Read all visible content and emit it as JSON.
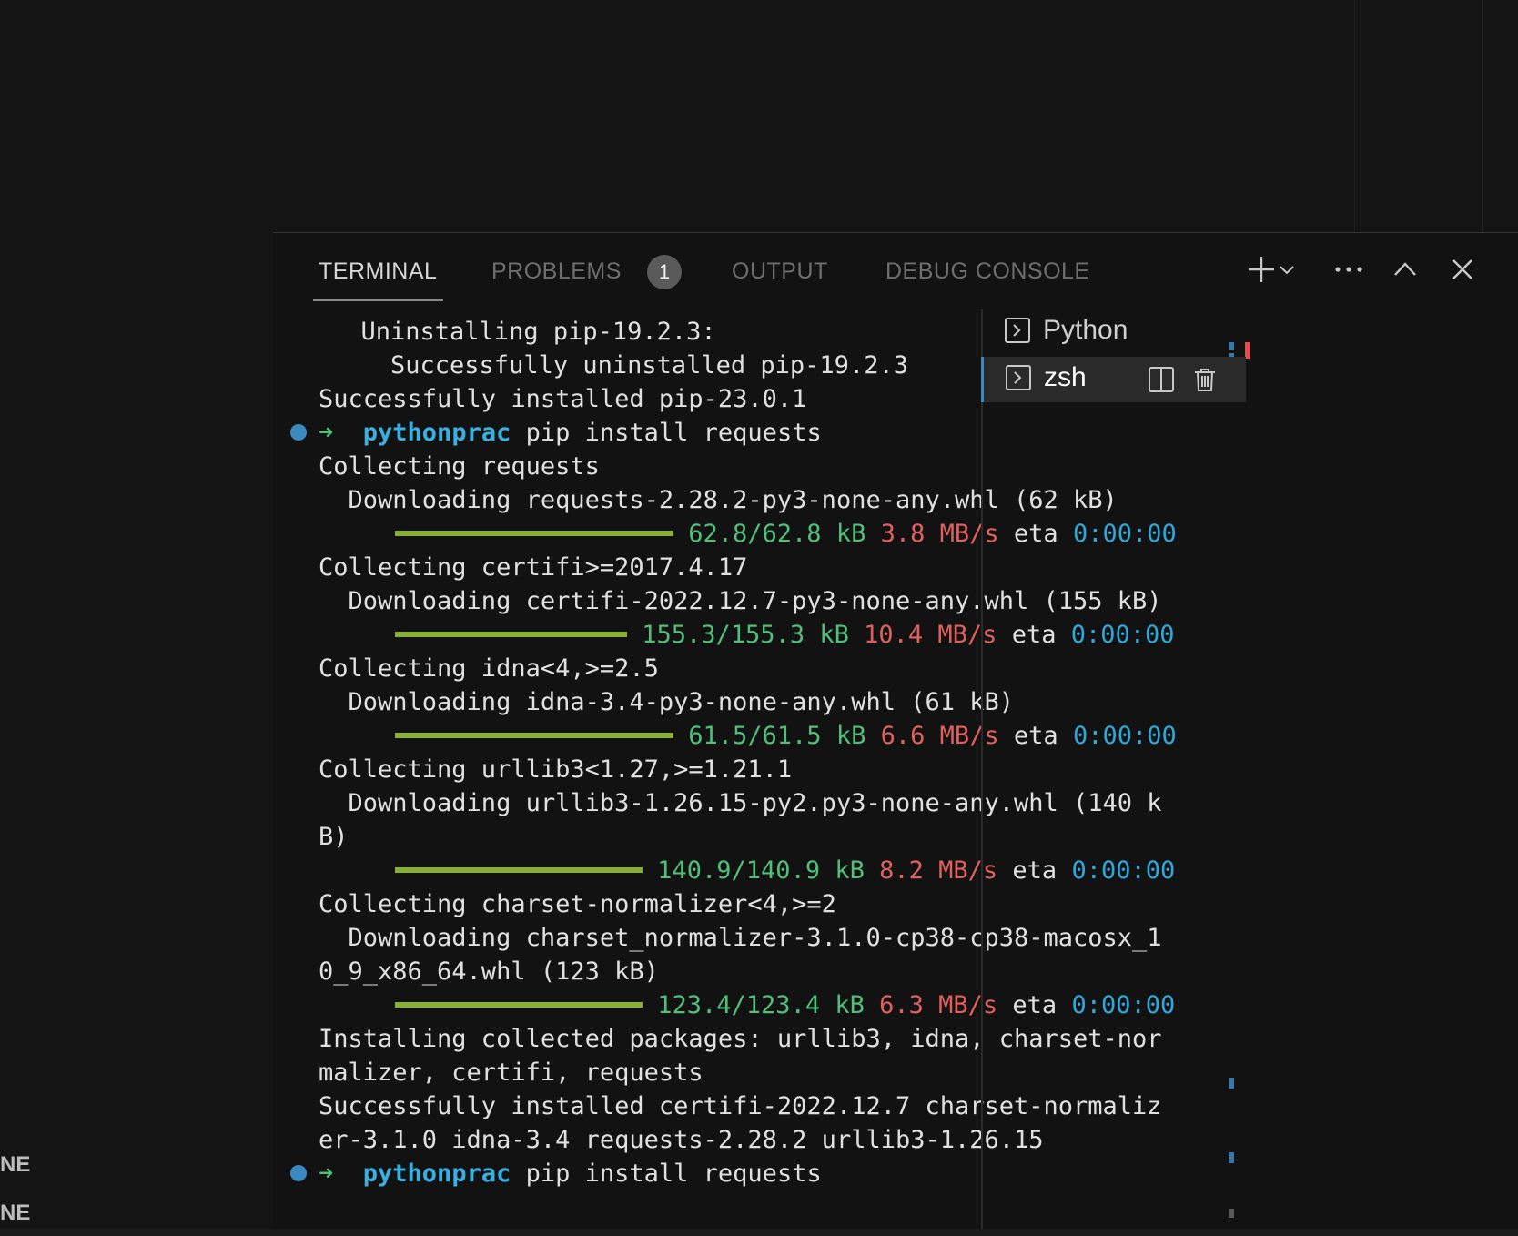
{
  "sidebar": {
    "labels": [
      "NE",
      "NE"
    ]
  },
  "panel": {
    "tabs": [
      {
        "label": "TERMINAL",
        "active": true
      },
      {
        "label": "PROBLEMS",
        "active": false
      },
      {
        "label": "OUTPUT",
        "active": false
      },
      {
        "label": "DEBUG CONSOLE",
        "active": false
      }
    ],
    "problems_count": "1",
    "actions": [
      "plus-icon",
      "chevron-down-icon",
      "ellipsis-icon",
      "chevron-up-icon",
      "close-icon"
    ]
  },
  "terminal": {
    "prompt_dir": "pythonprac",
    "prompt_arrow": "➜",
    "lines": {
      "l0": "  Uninstalling pip-19.2.3:",
      "l1": "    Successfully uninstalled pip-19.2.3",
      "l2": "Successfully installed pip-23.0.1",
      "cmd1": " pip install requests",
      "l4": "Collecting requests",
      "l5": "  Downloading requests-2.28.2-py3-none-any.whl (62 kB)",
      "p1_size": "62.8/62.8 kB",
      "p1_speed": "3.8 MB/s",
      "p1_eta_label": "eta",
      "p1_eta": "0:00:00",
      "l7": "Collecting certifi>=2017.4.17",
      "l8": "  Downloading certifi-2022.12.7-py3-none-any.whl (155 kB)",
      "p2_size": "155.3/155.3 kB",
      "p2_speed": "10.4 MB/s",
      "p2_eta_label": "eta",
      "p2_eta": "0:00:00",
      "l10": "Collecting idna<4,>=2.5",
      "l11": "  Downloading idna-3.4-py3-none-any.whl (61 kB)",
      "p3_size": "61.5/61.5 kB",
      "p3_speed": "6.6 MB/s",
      "p3_eta_label": "eta",
      "p3_eta": "0:00:00",
      "l13": "Collecting urllib3<1.27,>=1.21.1",
      "l14": "  Downloading urllib3-1.26.15-py2.py3-none-any.whl (140 k",
      "l15": "B)",
      "p4_size": "140.9/140.9 kB",
      "p4_speed": "8.2 MB/s",
      "p4_eta_label": "eta",
      "p4_eta": "0:00:00",
      "l17": "Collecting charset-normalizer<4,>=2",
      "l18": "  Downloading charset_normalizer-3.1.0-cp38-cp38-macosx_1",
      "l19": "0_9_x86_64.whl (123 kB)",
      "p5_size": "123.4/123.4 kB",
      "p5_speed": "6.3 MB/s",
      "p5_eta_label": "eta",
      "p5_eta": "0:00:00",
      "l21": "Installing collected packages: urllib3, idna, charset-nor",
      "l22": "malizer, certifi, requests",
      "l23": "Successfully installed certifi-2022.12.7 charset-normaliz",
      "l24": "er-3.1.0 idna-3.4 requests-2.28.2 urllib3-1.26.15",
      "cmd2": " pip install requests"
    },
    "progress": [
      1.0,
      1.0,
      1.0,
      1.0,
      1.0
    ]
  },
  "terminal_list": {
    "items": [
      {
        "label": "Python",
        "icon": "terminal-icon",
        "active": false
      },
      {
        "label": "zsh",
        "icon": "terminal-icon",
        "active": true
      }
    ],
    "active_actions": [
      "split-icon",
      "trash-icon"
    ]
  },
  "colors": {
    "progress_bar": "#8ab030",
    "size_text": "#4fbf7a",
    "speed_text": "#e0605e",
    "eta_text": "#2fa8d8",
    "prompt_dir": "#3ab0e0"
  }
}
